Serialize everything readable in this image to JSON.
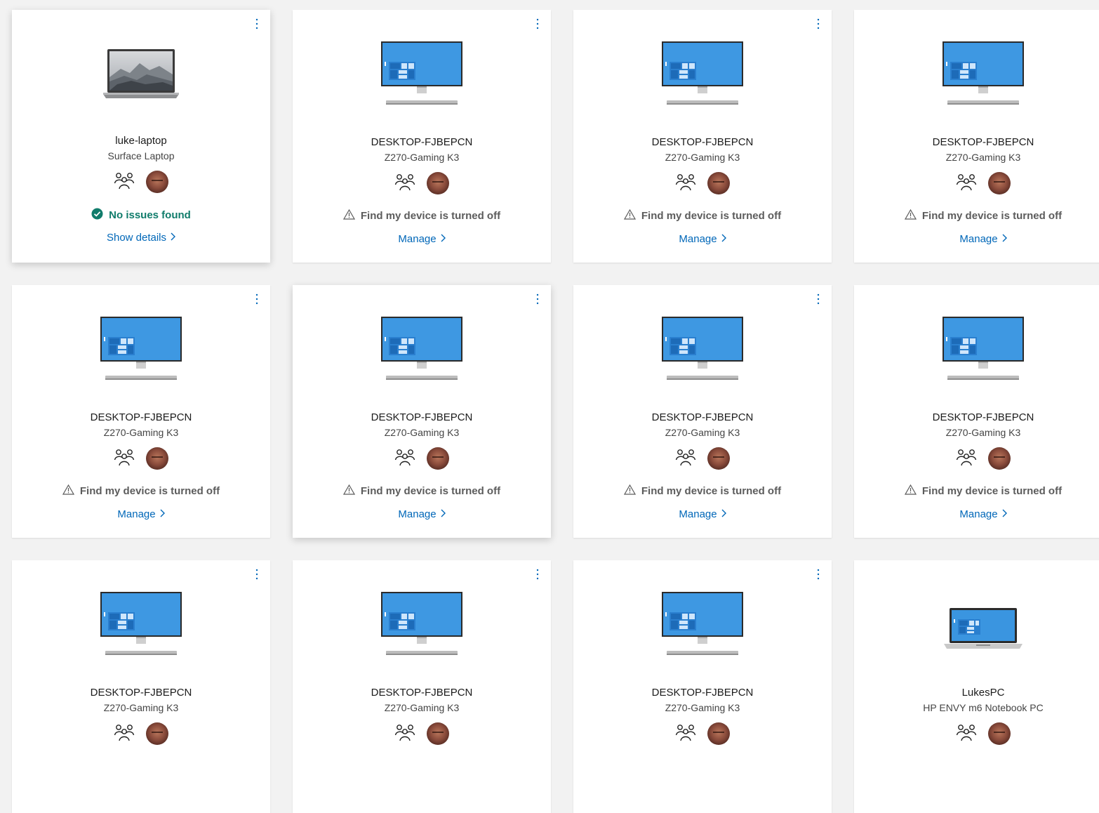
{
  "colors": {
    "page_background": "#f2f2f2",
    "card_background": "#ffffff",
    "link": "#0067b8",
    "ok_status": "#107c6b",
    "warn_status": "#5c5c5c",
    "screen_blue": "#3a95e0"
  },
  "icons": {
    "more": "more-options-icon",
    "family": "family-group-icon",
    "warning": "warning-icon",
    "check": "check-circle-icon",
    "chevron": "chevron-right-icon"
  },
  "devices": [
    {
      "name": "luke-laptop",
      "model": "Surface Laptop",
      "status": "No issues found",
      "status_kind": "ok",
      "action": "Show details",
      "image": "surface-laptop",
      "menu": true
    },
    {
      "name": "DESKTOP-FJBEPCN",
      "model": "Z270-Gaming K3",
      "status": "Find my device is turned off",
      "status_kind": "warning",
      "action": "Manage",
      "image": "desktop",
      "menu": true
    },
    {
      "name": "DESKTOP-FJBEPCN",
      "model": "Z270-Gaming K3",
      "status": "Find my device is turned off",
      "status_kind": "warning",
      "action": "Manage",
      "image": "desktop",
      "menu": true
    },
    {
      "name": "DESKTOP-FJBEPCN",
      "model": "Z270-Gaming K3",
      "status": "Find my device is turned off",
      "status_kind": "warning",
      "action": "Manage",
      "image": "desktop",
      "menu": false
    },
    {
      "name": "DESKTOP-FJBEPCN",
      "model": "Z270-Gaming K3",
      "status": "Find my device is turned off",
      "status_kind": "warning",
      "action": "Manage",
      "image": "desktop",
      "menu": true
    },
    {
      "name": "DESKTOP-FJBEPCN",
      "model": "Z270-Gaming K3",
      "status": "Find my device is turned off",
      "status_kind": "warning",
      "action": "Manage",
      "image": "desktop",
      "menu": true
    },
    {
      "name": "DESKTOP-FJBEPCN",
      "model": "Z270-Gaming K3",
      "status": "Find my device is turned off",
      "status_kind": "warning",
      "action": "Manage",
      "image": "desktop",
      "menu": true
    },
    {
      "name": "DESKTOP-FJBEPCN",
      "model": "Z270-Gaming K3",
      "status": "Find my device is turned off",
      "status_kind": "warning",
      "action": "Manage",
      "image": "desktop",
      "menu": false
    },
    {
      "name": "DESKTOP-FJBEPCN",
      "model": "Z270-Gaming K3",
      "status": "",
      "status_kind": "",
      "action": "",
      "image": "desktop",
      "menu": true
    },
    {
      "name": "DESKTOP-FJBEPCN",
      "model": "Z270-Gaming K3",
      "status": "",
      "status_kind": "",
      "action": "",
      "image": "desktop",
      "menu": true
    },
    {
      "name": "DESKTOP-FJBEPCN",
      "model": "Z270-Gaming K3",
      "status": "",
      "status_kind": "",
      "action": "",
      "image": "desktop",
      "menu": true
    },
    {
      "name": "LukesPC",
      "model": "HP ENVY m6 Notebook PC",
      "status": "",
      "status_kind": "",
      "action": "",
      "image": "laptop",
      "menu": false
    }
  ]
}
